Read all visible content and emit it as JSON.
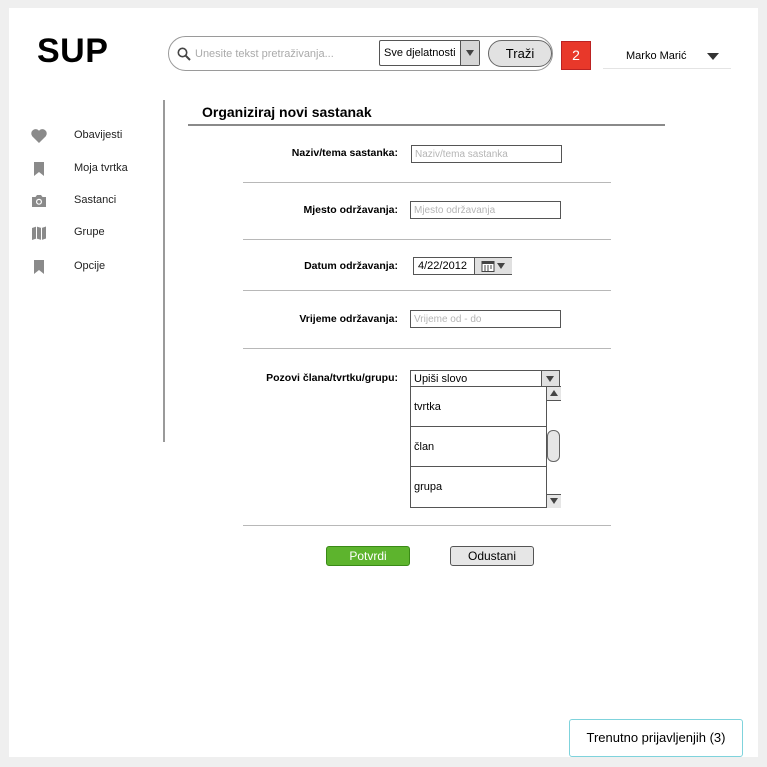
{
  "app": {
    "logo": "SUP"
  },
  "header": {
    "search_placeholder": "Unesite tekst pretraživanja...",
    "scope_selected": "Sve djelatnosti",
    "search_button": "Traži",
    "notification_count": "2",
    "user_name": "Marko Marić"
  },
  "sidebar": {
    "items": [
      {
        "label": "Obavijesti",
        "icon": "heart-icon"
      },
      {
        "label": "Moja tvrtka",
        "icon": "bookmark-icon"
      },
      {
        "label": "Sastanci",
        "icon": "camera-icon"
      },
      {
        "label": "Grupe",
        "icon": "map-icon"
      },
      {
        "label": "Opcije",
        "icon": "bookmark-icon"
      }
    ]
  },
  "form": {
    "title": "Organiziraj novi sastanak",
    "topic": {
      "label": "Naziv/tema sastanka:",
      "placeholder": "Naziv/tema sastanka"
    },
    "place": {
      "label": "Mjesto održavanja:",
      "placeholder": "Mjesto održavanja"
    },
    "date": {
      "label": "Datum održavanja:",
      "value": "4/22/2012"
    },
    "time": {
      "label": "Vrijeme održavanja:",
      "placeholder": "Vrijeme od - do"
    },
    "invite": {
      "label": "Pozovi člana/tvrtku/grupu:",
      "combo_value": "Upiši slovo",
      "options": [
        "tvrtka",
        "član",
        "grupa"
      ]
    },
    "confirm_button": "Potvrdi",
    "cancel_button": "Odustani"
  },
  "footer": {
    "online_users": "Trenutno prijavljenjih (3)"
  },
  "colors": {
    "confirm": "#5db42d",
    "badge": "#e8382a",
    "online_border": "#7fd3dc"
  }
}
